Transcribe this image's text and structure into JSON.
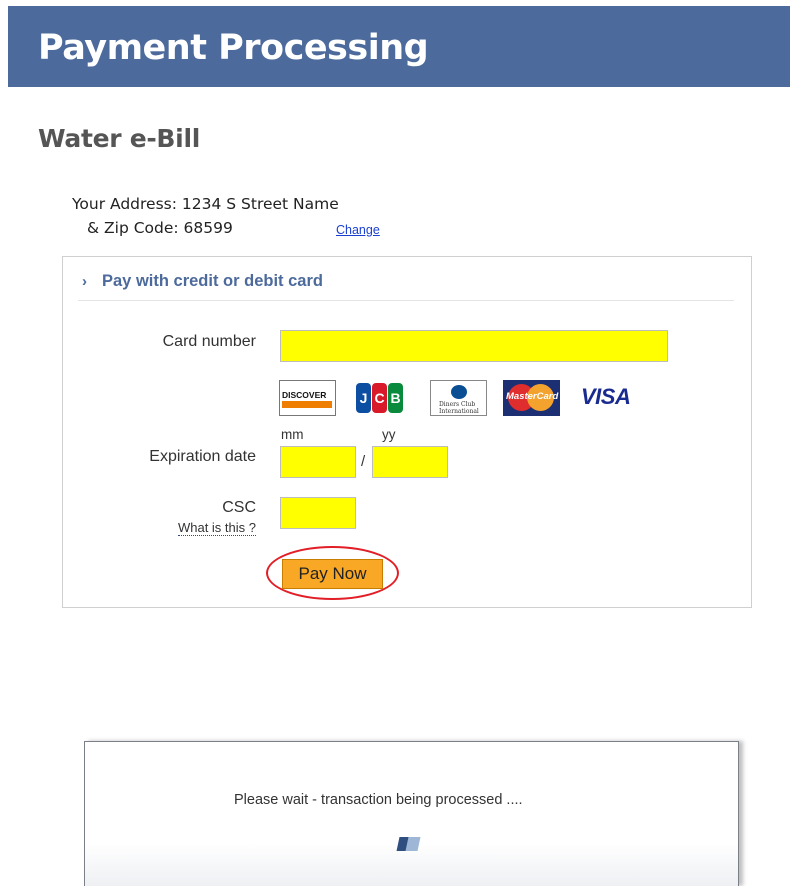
{
  "header": {
    "title": "Payment Processing"
  },
  "bill": {
    "title": "Water e-Bill"
  },
  "address": {
    "line1": "Your Address: 1234 S Street Name",
    "line2": "& Zip Code: 68599",
    "change_link": "Change"
  },
  "payment": {
    "section_title": "Pay with credit or debit card",
    "card_number_label": "Card number",
    "card_number_value": "",
    "card_brands": [
      "Discover",
      "JCB",
      "Diners Club International",
      "MasterCard",
      "VISA"
    ],
    "mm_label": "mm",
    "yy_label": "yy",
    "expiration_label": "Expiration date",
    "exp_month_value": "",
    "exp_year_value": "",
    "date_separator": "/",
    "csc_label": "CSC",
    "csc_help_link": "What is this ?",
    "csc_value": "",
    "pay_button": "Pay Now"
  },
  "logos": {
    "discover": "DISCOVER",
    "jcb": [
      "J",
      "C",
      "B"
    ],
    "diners": "Diners Club International",
    "mastercard": "MasterCard",
    "visa": "VISA"
  },
  "wait": {
    "message": "Please wait - transaction being processed ...."
  },
  "colors": {
    "header_bg": "#4c6a9b",
    "field_highlight": "#ffff00",
    "pay_button": "#f9a825",
    "annotation_ring": "#e21e26",
    "link": "#1a3fd1"
  },
  "icons": {
    "section_chevron": "chevron-right-icon",
    "spinner": "loading-spinner-icon"
  }
}
